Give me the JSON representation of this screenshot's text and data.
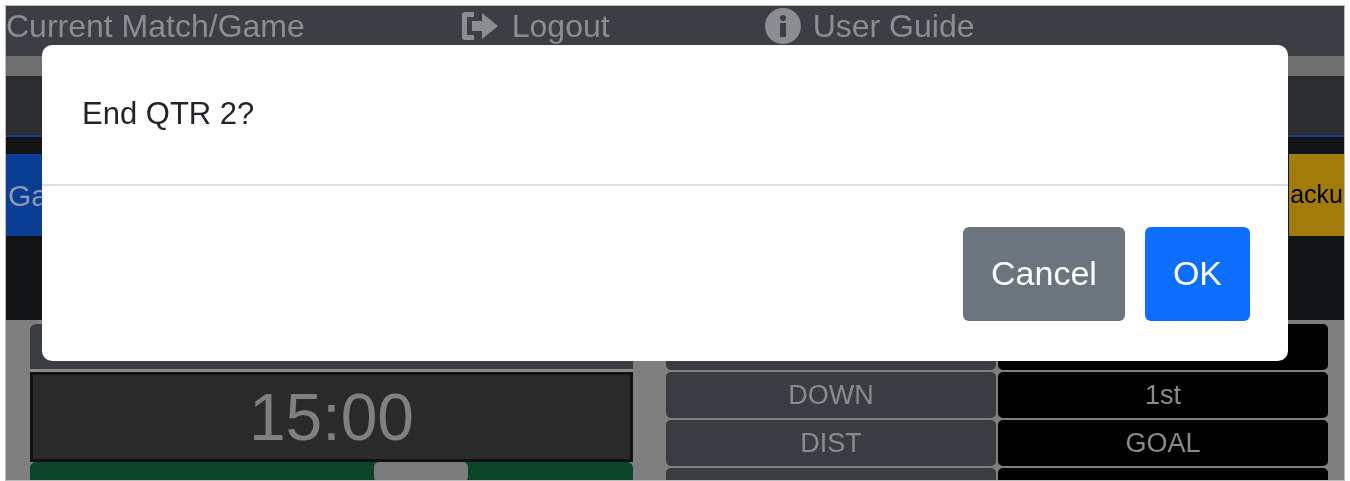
{
  "nav": [
    {
      "label": "Current Match/Game"
    },
    {
      "label": "Logout"
    },
    {
      "label": "User Guide"
    }
  ],
  "action_buttons": [
    {
      "label": "Ga",
      "kind": "primary"
    },
    {
      "label": "acku",
      "kind": "warning"
    }
  ],
  "clock": "15:00",
  "game_rows": [
    {
      "label": "DOWN",
      "value": "1st"
    },
    {
      "label": "DIST",
      "value": "GOAL"
    }
  ],
  "dialog": {
    "message": "End QTR 2?",
    "buttons": [
      {
        "label": "Cancel",
        "kind": "secondary"
      },
      {
        "label": "OK",
        "kind": "primary"
      }
    ]
  }
}
